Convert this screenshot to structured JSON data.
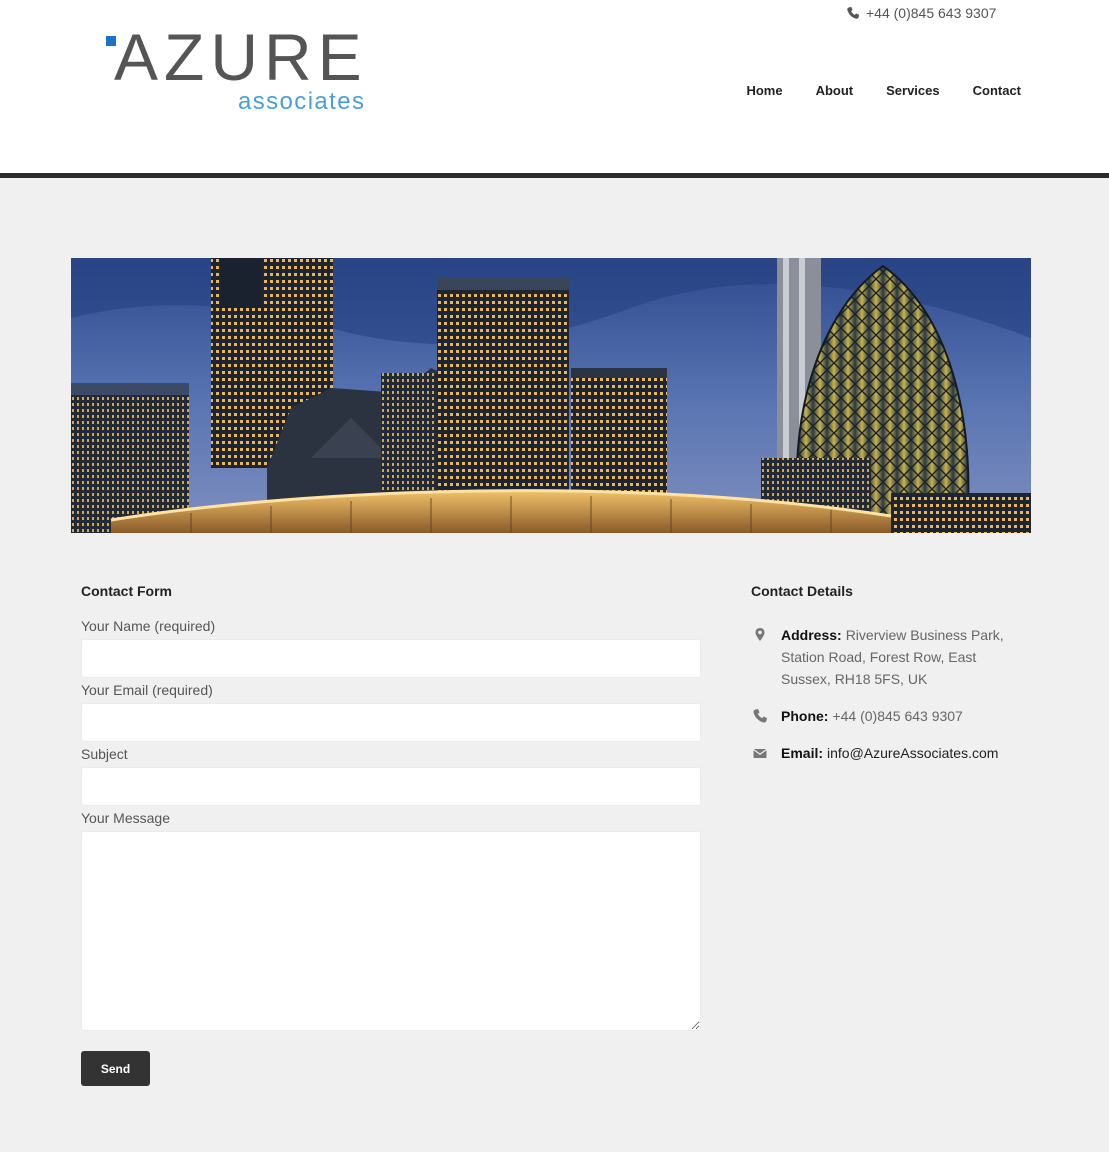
{
  "header": {
    "phone": "+44 (0)845 643 9307",
    "logo": {
      "word": "AZURE",
      "sub": "associates"
    },
    "nav": [
      {
        "label": "Home"
      },
      {
        "label": "About"
      },
      {
        "label": "Services"
      },
      {
        "label": "Contact"
      }
    ]
  },
  "colors": {
    "brand_blue": "#1a73c8",
    "logo_sub": "#4a9fd8",
    "header_rule": "#2b2b2b",
    "button": "#333333"
  },
  "contact_form": {
    "title": "Contact Form",
    "fields": [
      {
        "label": "Your Name (required)",
        "value": ""
      },
      {
        "label": "Your Email (required)",
        "value": ""
      },
      {
        "label": "Subject",
        "value": ""
      },
      {
        "label": "Your Message",
        "value": ""
      }
    ],
    "send_label": "Send"
  },
  "contact_details": {
    "title": "Contact Details",
    "address": {
      "label": "Address:",
      "value": "Riverview Business Park, Station Road, Forest Row, East Sussex, RH18 5FS, UK",
      "icon": "map-pin-icon"
    },
    "phone": {
      "label": "Phone:",
      "value": "+44 (0)845 643 9307",
      "icon": "phone-icon"
    },
    "email": {
      "label": "Email:",
      "value": "info@AzureAssociates.com",
      "icon": "envelope-icon"
    }
  }
}
